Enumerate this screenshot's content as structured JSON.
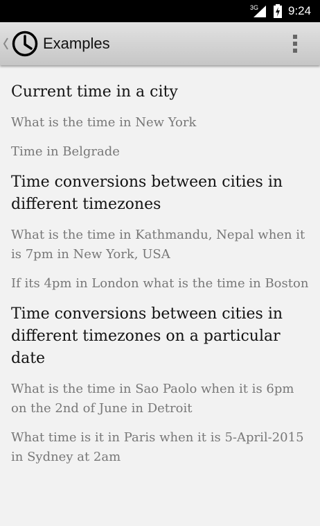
{
  "statusbar": {
    "network": "3G",
    "time": "9:24"
  },
  "actionbar": {
    "title": "Examples",
    "icon": "clock-icon"
  },
  "sections": [
    {
      "heading": "Current time in a city",
      "examples": [
        "What is the time in New York",
        "Time in Belgrade"
      ]
    },
    {
      "heading": "Time conversions between cities in different timezones",
      "examples": [
        "What is the time in Kathmandu, Nepal when it is 7pm in New York, USA",
        "If its 4pm in London what is the time in Boston"
      ]
    },
    {
      "heading": "Time conversions between cities in different timezones on a particular date",
      "examples": [
        "What is the time in Sao Paolo when it is 6pm on the 2nd of June in Detroit",
        "What time is it in Paris when it is 5-April-2015 in Sydney at 2am"
      ]
    }
  ]
}
